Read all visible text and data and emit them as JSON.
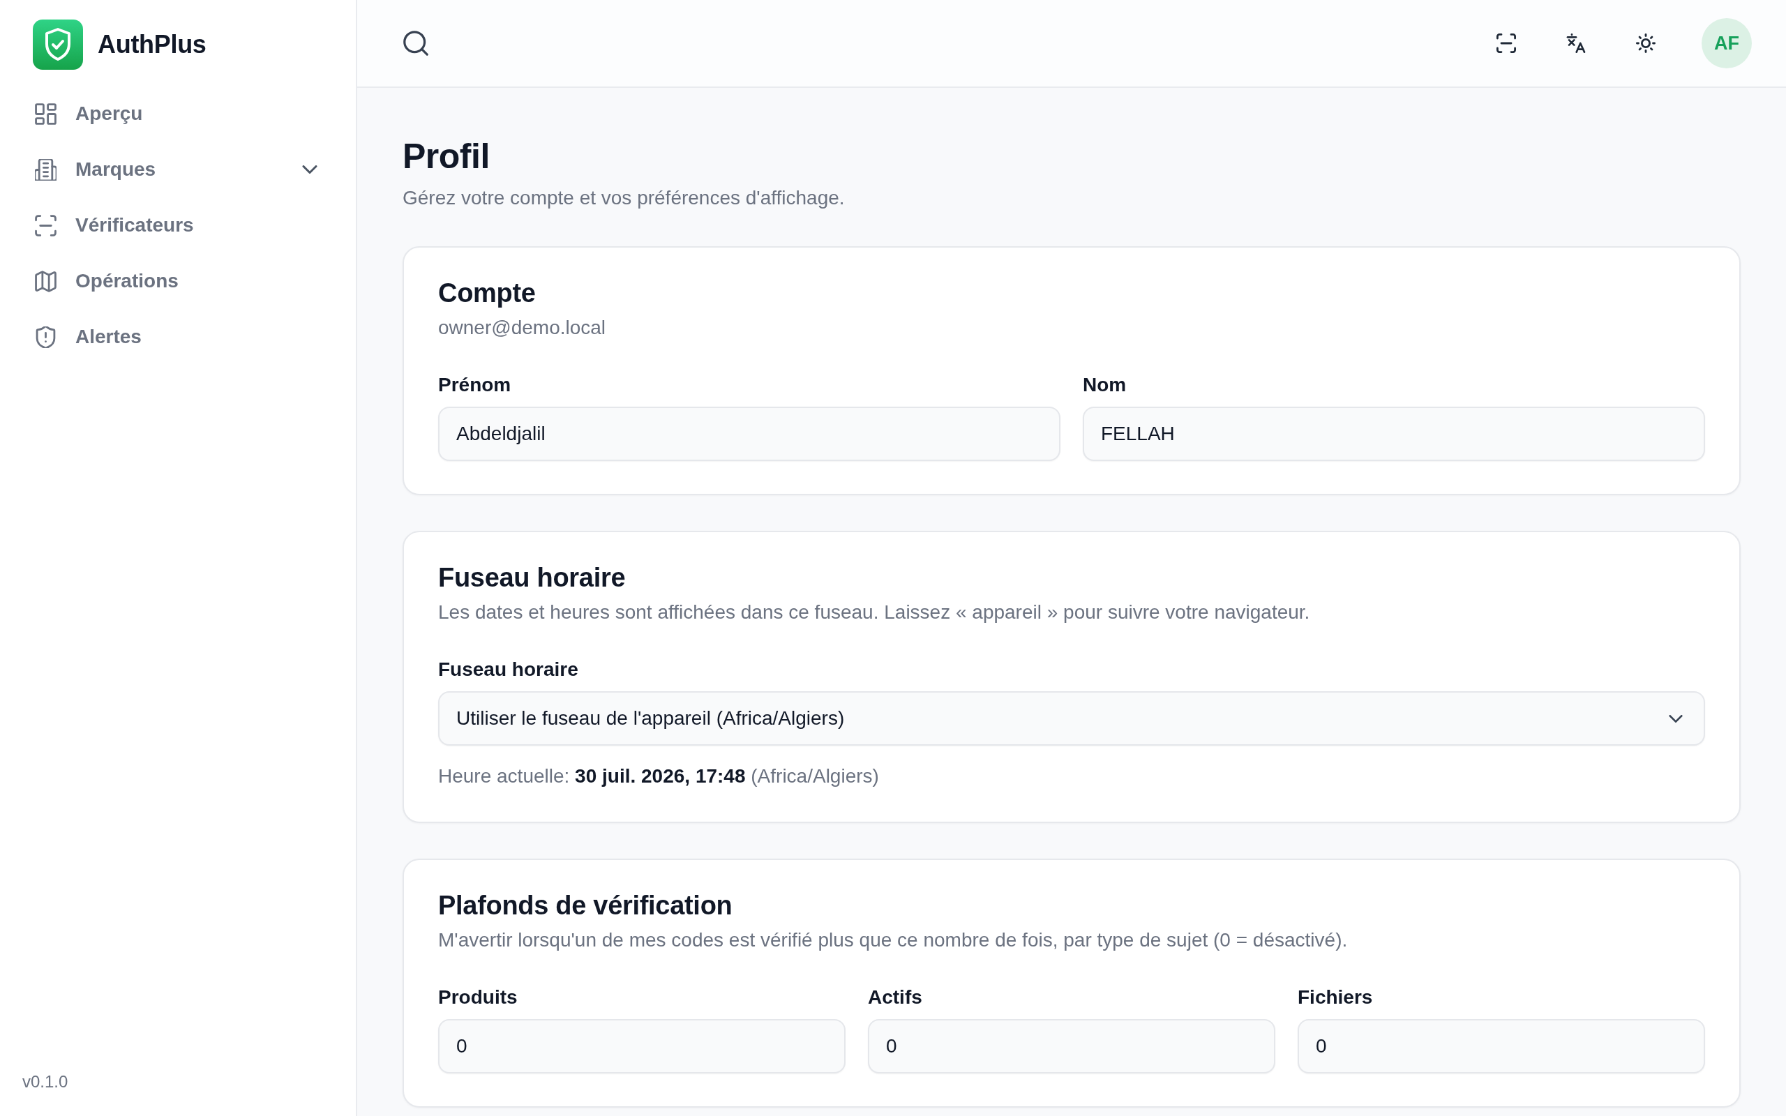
{
  "sidebar": {
    "brand": "AuthPlus",
    "items": [
      {
        "label": "Aperçu",
        "kind": "link",
        "selected": false
      },
      {
        "label": "Marques",
        "kind": "group",
        "selected": false,
        "expanded": false
      },
      {
        "label": "Vérificateurs",
        "kind": "link",
        "selected": false
      },
      {
        "label": "Opérations",
        "kind": "link",
        "selected": false
      },
      {
        "label": "Alertes",
        "kind": "link",
        "selected": false
      }
    ],
    "version": "v0.1.0"
  },
  "topbar": {
    "avatar": "AF"
  },
  "page": {
    "title": "Profil",
    "subtitle": "Gérez votre compte et vos préférences d'affichage."
  },
  "cards": [
    {
      "title": "Compte",
      "description": "owner@demo.local",
      "fields": [
        {
          "kind": "text",
          "label": "Prénom",
          "value": "Abdeldjalil"
        },
        {
          "kind": "text",
          "label": "Nom",
          "value": "FELLAH"
        }
      ]
    },
    {
      "title": "Fuseau horaire",
      "description": "Les dates et heures sont affichées dans ce fuseau. Laissez « appareil » pour suivre votre navigateur.",
      "fields": [
        {
          "kind": "select",
          "label": "Fuseau horaire",
          "value": "Utiliser le fuseau de l'appareil (Africa/Algiers)"
        }
      ],
      "note": "Heure actuelle: **30 juil. 2026, 17:48** (Africa/Algiers)"
    },
    {
      "title": "Plafonds de vérification",
      "description": "M'avertir lorsqu'un de mes codes est vérifié plus que ce nombre de fois, par type de sujet (0 = désactivé).",
      "fields": [
        {
          "kind": "text",
          "label": "Produits",
          "value": "0"
        },
        {
          "kind": "text",
          "label": "Actifs",
          "value": "0"
        },
        {
          "kind": "text",
          "label": "Fichiers",
          "value": "0"
        }
      ]
    }
  ]
}
